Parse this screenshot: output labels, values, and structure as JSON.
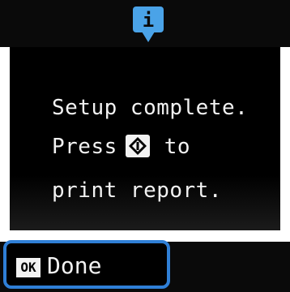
{
  "status_icon": {
    "name": "info-icon",
    "glyph": "i",
    "color": "#4aa3e8"
  },
  "message": {
    "line1": "Setup complete.",
    "line2_before": "Press",
    "line2_key_icon": "start-diamond-icon",
    "line2_after": "to",
    "line3": "print report."
  },
  "footer": {
    "ok_badge": "OK",
    "done_label": "Done"
  },
  "colors": {
    "background": "#000000",
    "text": "#f2f2f2",
    "focus_border": "#2f7fd6",
    "info_icon": "#4aa3e8"
  }
}
